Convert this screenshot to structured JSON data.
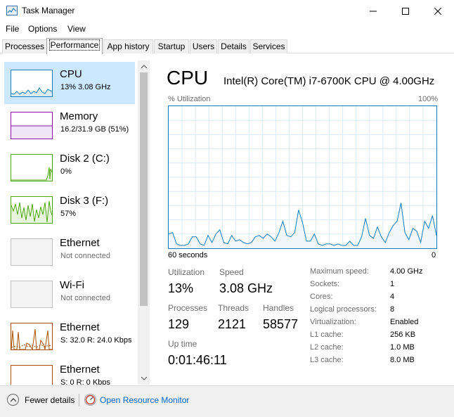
{
  "window": {
    "title": "Task Manager"
  },
  "menu": [
    "File",
    "Options",
    "View"
  ],
  "tabs": [
    "Processes",
    "Performance",
    "App history",
    "Startup",
    "Users",
    "Details",
    "Services"
  ],
  "active_tab": "Performance",
  "resources": [
    {
      "name": "CPU",
      "sub": "13% 3.08 GHz",
      "color": "#117dbb"
    },
    {
      "name": "Memory",
      "sub": "16.2/31.9 GB (51%)",
      "color": "#8b12ae"
    },
    {
      "name": "Disk 2 (C:)",
      "sub": "0%",
      "color": "#4da60c"
    },
    {
      "name": "Disk 3 (F:)",
      "sub": "57%",
      "color": "#4da60c"
    },
    {
      "name": "Ethernet",
      "sub": "Not connected",
      "color": "#a74f01"
    },
    {
      "name": "Wi-Fi",
      "sub": "Not connected",
      "color": "#a74f01"
    },
    {
      "name": "Ethernet",
      "sub": "S: 32.0  R: 24.0 Kbps",
      "color": "#a74f01"
    },
    {
      "name": "Ethernet",
      "sub": "S: 0  R: 0 Kbps",
      "color": "#a74f01"
    }
  ],
  "cpu": {
    "title": "CPU",
    "model": "Intel(R) Core(TM) i7-6700K CPU @ 4.00GHz",
    "graph_label_tl": "% Utilization",
    "graph_label_tr": "100%",
    "graph_label_bl": "60 seconds",
    "graph_label_br": "0",
    "stats": {
      "utilization_label": "Utilization",
      "utilization_value": "13%",
      "speed_label": "Speed",
      "speed_value": "3.08 GHz",
      "processes_label": "Processes",
      "processes_value": "129",
      "threads_label": "Threads",
      "threads_value": "2121",
      "handles_label": "Handles",
      "handles_value": "58577",
      "uptime_label": "Up time",
      "uptime_value": "0:01:46:11"
    },
    "specs": [
      {
        "label": "Maximum speed:",
        "value": "4.00 GHz"
      },
      {
        "label": "Sockets:",
        "value": "1"
      },
      {
        "label": "Cores:",
        "value": "4"
      },
      {
        "label": "Logical processors:",
        "value": "8"
      },
      {
        "label": "Virtualization:",
        "value": "Enabled"
      },
      {
        "label": "L1 cache:",
        "value": "256 KB"
      },
      {
        "label": "L2 cache:",
        "value": "1.0 MB"
      },
      {
        "label": "L3 cache:",
        "value": "8.0 MB"
      }
    ]
  },
  "chart_data": {
    "type": "area",
    "xlabel": "60 seconds",
    "ylabel": "% Utilization",
    "ylim": [
      0,
      100
    ],
    "values": [
      10,
      11,
      3,
      2,
      2,
      3,
      8,
      8,
      3,
      2,
      9,
      4,
      10,
      13,
      4,
      3,
      9,
      5,
      6,
      4,
      3,
      4,
      8,
      9,
      7,
      10,
      8,
      5,
      11,
      19,
      9,
      8,
      11,
      27,
      18,
      5,
      5,
      10,
      3,
      2,
      3,
      3,
      2,
      3,
      2,
      2,
      5,
      2,
      2,
      8,
      21,
      9,
      7,
      15,
      8,
      4,
      11,
      16,
      19,
      32,
      11,
      6,
      14,
      12,
      4,
      19,
      14,
      23,
      9
    ]
  },
  "footer": {
    "fewer_details": "Fewer details",
    "open_resmon": "Open Resource Monitor"
  }
}
